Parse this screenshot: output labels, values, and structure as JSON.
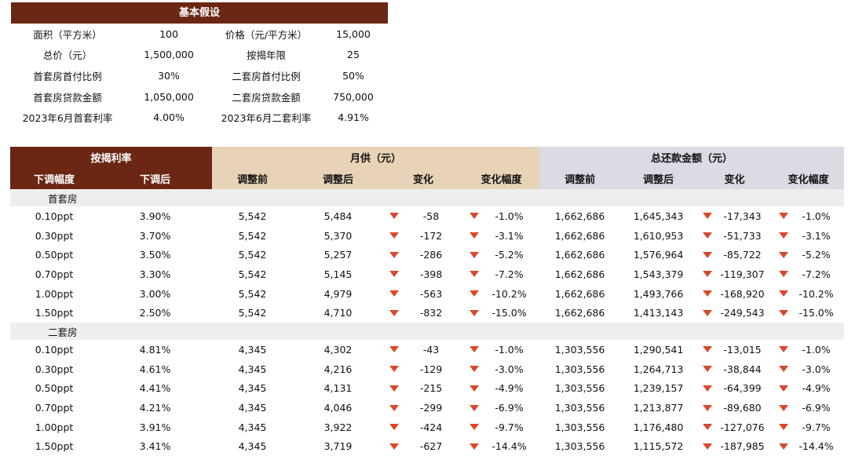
{
  "assumptions": {
    "title": "基本假设",
    "rows": [
      [
        "面积（平方米）",
        "100",
        "价格（元/平方米）",
        "15,000"
      ],
      [
        "总价（元）",
        "1,500,000",
        "按揭年限",
        "25"
      ],
      [
        "首套房首付比例",
        "30%",
        "二套房首付比例",
        "50%"
      ],
      [
        "首套房贷款金额",
        "1,050,000",
        "二套房贷款金额",
        "750,000"
      ],
      [
        "2023年6月首套利率",
        "4.00%",
        "2023年6月二套利率",
        "4.91%"
      ]
    ]
  },
  "table": {
    "group_headers": {
      "rate": "按揭利率",
      "monthly": "月供（元）",
      "total": "总还款金额（元）"
    },
    "sub_headers": [
      "下调幅度",
      "下调后",
      "调整前",
      "调整后",
      "变化",
      "变化幅度",
      "调整前",
      "调整后",
      "变化",
      "变化幅度"
    ],
    "sections": [
      {
        "label": "首套房",
        "rows": [
          [
            "0.10ppt",
            "3.90%",
            "5,542",
            "5,484",
            "-58",
            "-1.0%",
            "1,662,686",
            "1,645,343",
            "-17,343",
            "-1.0%"
          ],
          [
            "0.30ppt",
            "3.70%",
            "5,542",
            "5,370",
            "-172",
            "-3.1%",
            "1,662,686",
            "1,610,953",
            "-51,733",
            "-3.1%"
          ],
          [
            "0.50ppt",
            "3.50%",
            "5,542",
            "5,257",
            "-286",
            "-5.2%",
            "1,662,686",
            "1,576,964",
            "-85,722",
            "-5.2%"
          ],
          [
            "0.70ppt",
            "3.30%",
            "5,542",
            "5,145",
            "-398",
            "-7.2%",
            "1,662,686",
            "1,543,379",
            "-119,307",
            "-7.2%"
          ],
          [
            "1.00ppt",
            "3.00%",
            "5,542",
            "4,979",
            "-563",
            "-10.2%",
            "1,662,686",
            "1,493,766",
            "-168,920",
            "-10.2%"
          ],
          [
            "1.50ppt",
            "2.50%",
            "5,542",
            "4,710",
            "-832",
            "-15.0%",
            "1,662,686",
            "1,413,143",
            "-249,543",
            "-15.0%"
          ]
        ]
      },
      {
        "label": "二套房",
        "rows": [
          [
            "0.10ppt",
            "4.81%",
            "4,345",
            "4,302",
            "-43",
            "-1.0%",
            "1,303,556",
            "1,290,541",
            "-13,015",
            "-1.0%"
          ],
          [
            "0.30ppt",
            "4.61%",
            "4,345",
            "4,216",
            "-129",
            "-3.0%",
            "1,303,556",
            "1,264,713",
            "-38,844",
            "-3.0%"
          ],
          [
            "0.50ppt",
            "4.41%",
            "4,345",
            "4,131",
            "-215",
            "-4.9%",
            "1,303,556",
            "1,239,157",
            "-64,399",
            "-4.9%"
          ],
          [
            "0.70ppt",
            "4.21%",
            "4,345",
            "4,046",
            "-299",
            "-6.9%",
            "1,303,556",
            "1,213,877",
            "-89,680",
            "-6.9%"
          ],
          [
            "1.00ppt",
            "3.91%",
            "4,345",
            "3,922",
            "-424",
            "-9.7%",
            "1,303,556",
            "1,176,480",
            "-127,076",
            "-9.7%"
          ],
          [
            "1.50ppt",
            "3.41%",
            "4,345",
            "3,719",
            "-627",
            "-14.4%",
            "1,303,556",
            "1,115,572",
            "-187,985",
            "-14.4%"
          ]
        ]
      }
    ]
  },
  "colors": {
    "header_dark": "#6b2614",
    "header_tan": "#e9d3b8",
    "header_gray": "#dadbe4",
    "section_bg": "#eeeeee",
    "down_arrow": "#d9482b"
  }
}
